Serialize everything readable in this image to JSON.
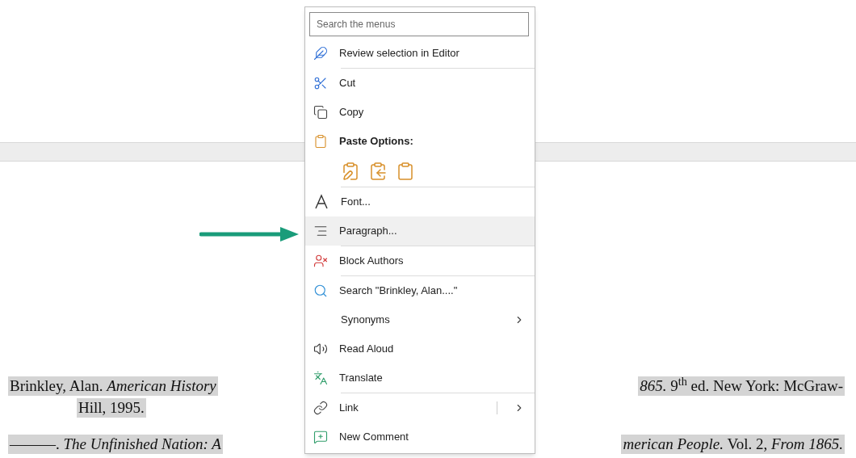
{
  "document": {
    "lines": [
      {
        "left": "Brinkley, Alan. *American History*",
        "right": "*865.* 9$^{th}$ ed. New York: McGraw-",
        "indent": false
      },
      {
        "left": "Hill, 1995.",
        "indent": true
      },
      {
        "left": "———. *The Unfinished Nation: A*",
        "right": "*merican People.* Vol. 2, *From 1865.*",
        "indent": false
      }
    ]
  },
  "context_menu": {
    "search": {
      "placeholder": "Search the menus"
    },
    "items": [
      {
        "kind": "item",
        "label": "Review selection in Editor",
        "selected": false,
        "submenu": false,
        "separator_after": true
      },
      {
        "kind": "item",
        "label": "Cut",
        "selected": false,
        "submenu": false,
        "separator_after": false
      },
      {
        "kind": "item",
        "label": "Copy",
        "selected": false,
        "submenu": false,
        "separator_after": false
      },
      {
        "kind": "header",
        "label": "Paste Options:",
        "separator_after": false
      },
      {
        "kind": "paste-icons",
        "separator_after": true
      },
      {
        "kind": "item",
        "label": "Font...",
        "selected": false,
        "submenu": false,
        "separator_after": false
      },
      {
        "kind": "item",
        "label": "Paragraph...",
        "selected": true,
        "submenu": false,
        "separator_after": true
      },
      {
        "kind": "item",
        "label": "Block Authors",
        "selected": false,
        "submenu": false,
        "separator_after": true
      },
      {
        "kind": "item",
        "label": "Search \"Brinkley, Alan....\"",
        "selected": false,
        "submenu": false,
        "separator_after": false
      },
      {
        "kind": "item",
        "label": "Synonyms",
        "selected": false,
        "submenu": true,
        "separator_after": false
      },
      {
        "kind": "item",
        "label": "Read Aloud",
        "selected": false,
        "submenu": false,
        "separator_after": false
      },
      {
        "kind": "item",
        "label": "Translate",
        "selected": false,
        "submenu": false,
        "separator_after": true
      },
      {
        "kind": "split",
        "label": "Link",
        "selected": false,
        "submenu": true,
        "separator_after": false
      },
      {
        "kind": "item",
        "label": "New Comment",
        "selected": false,
        "submenu": false,
        "separator_after": false
      }
    ]
  }
}
